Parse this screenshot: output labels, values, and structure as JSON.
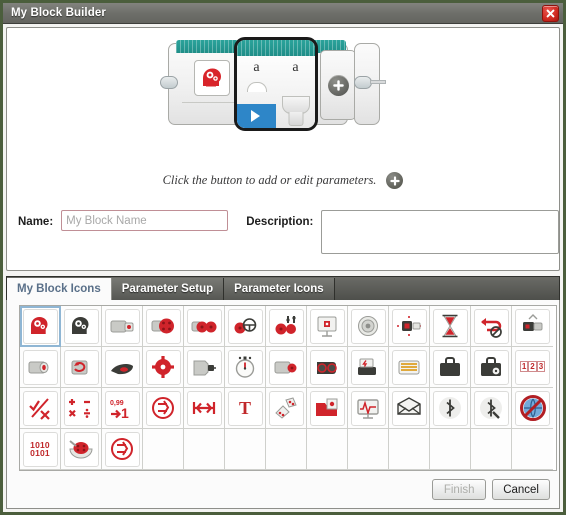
{
  "window": {
    "title": "My Block Builder",
    "close_icon": "close-icon"
  },
  "preview": {
    "block_icon": "head-with-gears-red-icon",
    "param_letter_1": "a",
    "param_letter_2": "a",
    "add_param_icon": "plus-icon",
    "hint_text": "Click the button to add or edit parameters.",
    "hint_plus_icon": "plus-icon"
  },
  "fields": {
    "name_label": "Name:",
    "name_value": "",
    "name_placeholder": "My Block Name",
    "description_label": "Description:",
    "description_value": "",
    "description_placeholder": ""
  },
  "tabs": [
    {
      "label": "My Block Icons",
      "active": true
    },
    {
      "label": "Parameter Setup",
      "active": false
    },
    {
      "label": "Parameter Icons",
      "active": false
    }
  ],
  "icon_grid": {
    "columns": 13,
    "rows": 4,
    "selected_index": 0,
    "cells": [
      {
        "name": "head-gears-red-icon",
        "glyph": ""
      },
      {
        "name": "head-gears-dark-icon",
        "glyph": ""
      },
      {
        "name": "large-motor-icon",
        "glyph": ""
      },
      {
        "name": "motor-rotation-icon",
        "glyph": ""
      },
      {
        "name": "two-motors-icon",
        "glyph": ""
      },
      {
        "name": "steering-motors-icon",
        "glyph": ""
      },
      {
        "name": "tank-motors-icon",
        "glyph": ""
      },
      {
        "name": "display-icon",
        "glyph": ""
      },
      {
        "name": "speaker-sound-icon",
        "glyph": ""
      },
      {
        "name": "brick-status-light-icon",
        "glyph": ""
      },
      {
        "name": "hourglass-wait-icon",
        "glyph": ""
      },
      {
        "name": "loop-interrupt-icon",
        "glyph": ""
      },
      {
        "name": "brick-button-icon",
        "glyph": ""
      },
      {
        "name": "touch-sensor-icon",
        "glyph": ""
      },
      {
        "name": "rotation-sensor-icon",
        "glyph": ""
      },
      {
        "name": "color-sensor-icon",
        "glyph": ""
      },
      {
        "name": "infrared-beacon-icon",
        "glyph": ""
      },
      {
        "name": "motor-port-icon",
        "glyph": ""
      },
      {
        "name": "timer-icon",
        "glyph": ""
      },
      {
        "name": "gyro-sensor-icon",
        "glyph": ""
      },
      {
        "name": "ultrasonic-sensor-icon",
        "glyph": ""
      },
      {
        "name": "energy-meter-icon",
        "glyph": ""
      },
      {
        "name": "temperature-sensor-icon",
        "glyph": ""
      },
      {
        "name": "file-case-icon",
        "glyph": ""
      },
      {
        "name": "file-case-lock-icon",
        "glyph": ""
      },
      {
        "name": "array-123-icon",
        "glyph": "1 2 3"
      },
      {
        "name": "logic-true-false-icon",
        "glyph": ""
      },
      {
        "name": "math-operations-icon",
        "glyph": ""
      },
      {
        "name": "round-number-icon",
        "glyph": ""
      },
      {
        "name": "compare-icon",
        "glyph": ""
      },
      {
        "name": "range-icon",
        "glyph": ""
      },
      {
        "name": "text-icon",
        "glyph": "T"
      },
      {
        "name": "random-dice-icon",
        "glyph": ""
      },
      {
        "name": "file-access-icon",
        "glyph": ""
      },
      {
        "name": "datalogging-icon",
        "glyph": ""
      },
      {
        "name": "messaging-envelope-icon",
        "glyph": ""
      },
      {
        "name": "bluetooth-icon",
        "glyph": ""
      },
      {
        "name": "bluetooth-settings-icon",
        "glyph": ""
      },
      {
        "name": "no-connection-icon",
        "glyph": ""
      },
      {
        "name": "raw-bytes-icon",
        "glyph": "1010 0101"
      },
      {
        "name": "unregulated-motor-icon",
        "glyph": ""
      },
      {
        "name": "compare-alt-icon",
        "glyph": ""
      },
      {
        "name": "empty-cell",
        "glyph": ""
      },
      {
        "name": "empty-cell",
        "glyph": ""
      },
      {
        "name": "empty-cell",
        "glyph": ""
      },
      {
        "name": "empty-cell",
        "glyph": ""
      },
      {
        "name": "empty-cell",
        "glyph": ""
      },
      {
        "name": "empty-cell",
        "glyph": ""
      },
      {
        "name": "empty-cell",
        "glyph": ""
      },
      {
        "name": "empty-cell",
        "glyph": ""
      },
      {
        "name": "empty-cell",
        "glyph": ""
      },
      {
        "name": "empty-cell",
        "glyph": ""
      }
    ]
  },
  "footer": {
    "finish_label": "Finish",
    "finish_enabled": false,
    "cancel_label": "Cancel",
    "cancel_enabled": true
  },
  "colors": {
    "titlebar": "#6e6f6a",
    "window_border": "#4b5e3c",
    "block_header_teal": "#1f8e88",
    "selection_blue": "#2e86c8",
    "accent_red": "#c0282a",
    "close_red": "#cf2920",
    "active_tab_text": "#5a7089"
  }
}
